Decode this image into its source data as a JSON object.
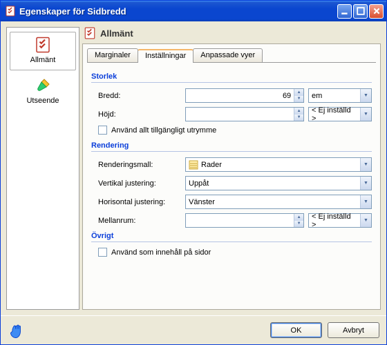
{
  "window": {
    "title": "Egenskaper för Sidbredd"
  },
  "sidebar": {
    "items": [
      {
        "label": "Allmänt",
        "selected": true
      },
      {
        "label": "Utseende",
        "selected": false
      }
    ]
  },
  "main": {
    "heading": "Allmänt",
    "tabs": [
      {
        "label": "Marginaler",
        "active": false
      },
      {
        "label": "Inställningar",
        "active": true
      },
      {
        "label": "Anpassade vyer",
        "active": false
      }
    ],
    "groups": {
      "storlek": {
        "title": "Storlek",
        "width_label": "Bredd:",
        "width_value": "69",
        "width_unit": "em",
        "height_label": "Höjd:",
        "height_value": "",
        "height_unit": "< Ej inställd >",
        "use_all_label": "Använd allt tillgängligt utrymme",
        "use_all_checked": false
      },
      "rendering": {
        "title": "Rendering",
        "template_label": "Renderingsmall:",
        "template_value": "Rader",
        "valign_label": "Vertikal justering:",
        "valign_value": "Uppåt",
        "halign_label": "Horisontal justering:",
        "halign_value": "Vänster",
        "gap_label": "Mellanrum:",
        "gap_value": "",
        "gap_unit": "< Ej inställd >"
      },
      "ovrigt": {
        "title": "Övrigt",
        "as_content_label": "Använd som innehåll på sidor",
        "as_content_checked": false
      }
    }
  },
  "footer": {
    "ok": "OK",
    "cancel": "Avbryt"
  }
}
